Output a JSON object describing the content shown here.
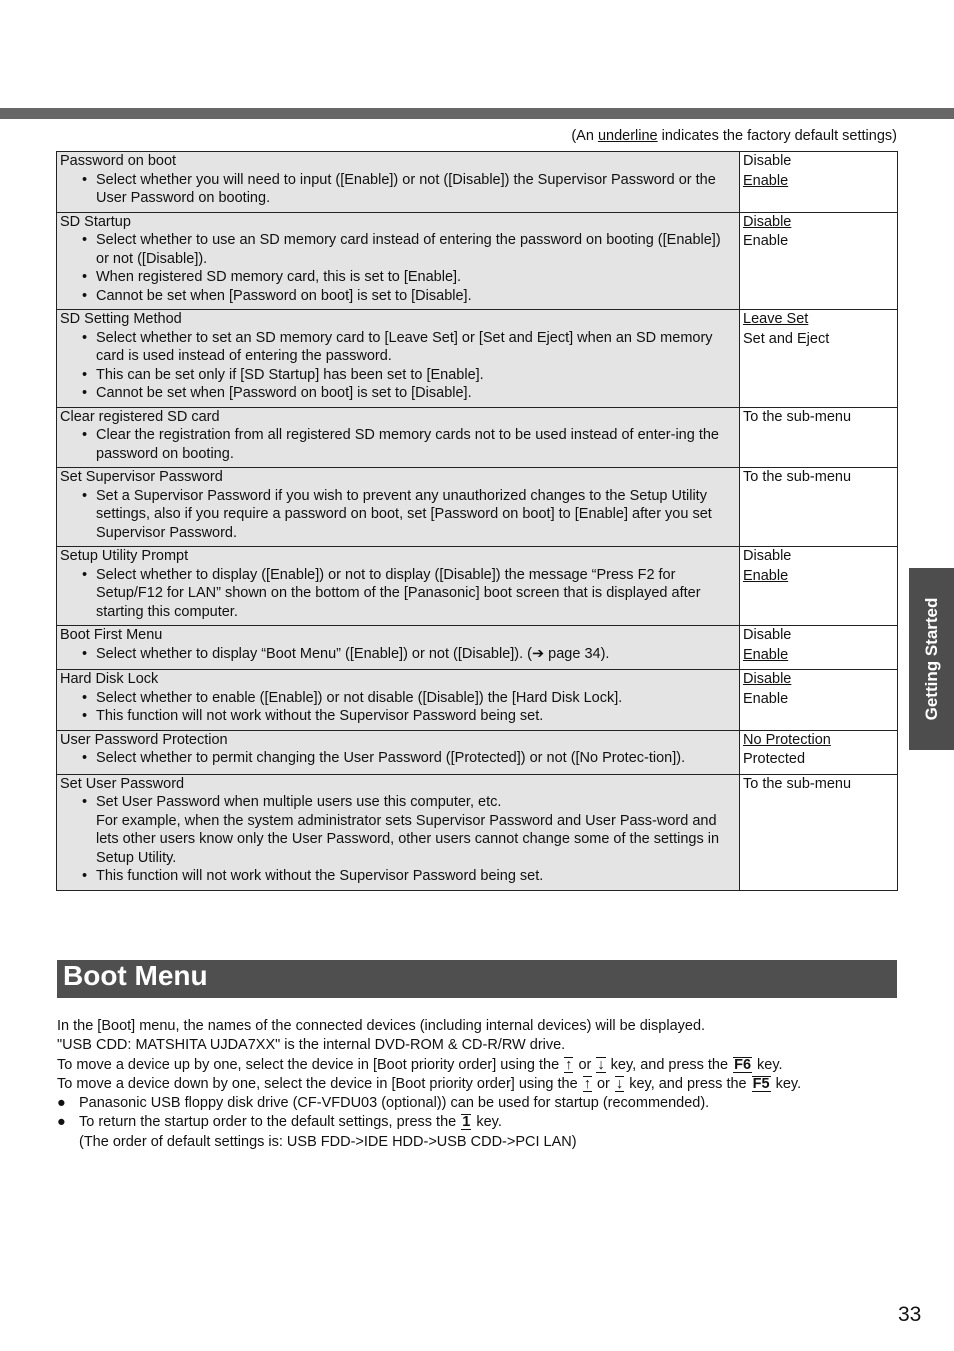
{
  "legend_note": {
    "prefix": "(An ",
    "underlined": "underline",
    "suffix": " indicates the factory default settings)"
  },
  "rows": [
    {
      "title": "Password on boot",
      "bullets": [
        {
          "bullet": true,
          "text": "Select whether you will need to input ([Enable]) or not ([Disable]) the Supervisor Password or the User Password on booting."
        }
      ],
      "options": [
        {
          "label": "Disable",
          "default": false
        },
        {
          "label": "Enable",
          "default": true
        }
      ]
    },
    {
      "title": "SD Startup",
      "bullets": [
        {
          "bullet": true,
          "text": "Select whether to use an SD memory card instead of entering the password on booting ([Enable]) or not ([Disable])."
        },
        {
          "bullet": true,
          "text": "When registered SD memory card, this is set to [Enable]."
        },
        {
          "bullet": true,
          "text": "Cannot be set when [Password on boot] is set to [Disable]."
        }
      ],
      "options": [
        {
          "label": "Disable",
          "default": true
        },
        {
          "label": "Enable",
          "default": false
        }
      ]
    },
    {
      "title": "SD Setting Method",
      "bullets": [
        {
          "bullet": true,
          "text": "Select whether to set an SD memory card to [Leave Set] or [Set and Eject] when an SD memory card is used instead of entering the password."
        },
        {
          "bullet": true,
          "text": "This can be set only if [SD Startup] has been set to [Enable]."
        },
        {
          "bullet": true,
          "text": "Cannot be set when [Password on boot] is set to [Disable]."
        }
      ],
      "options": [
        {
          "label": "Leave Set",
          "default": true
        },
        {
          "label": "Set and Eject",
          "default": false
        }
      ]
    },
    {
      "title": "Clear registered SD card",
      "bullets": [
        {
          "bullet": true,
          "text": "Clear the registration from all registered SD memory cards not to be used instead of enter-ing the password on booting."
        }
      ],
      "options": [
        {
          "label": "To the sub-menu",
          "default": false
        }
      ]
    },
    {
      "title": "Set Supervisor Password",
      "bullets": [
        {
          "bullet": true,
          "text": "Set a Supervisor Password if you wish to prevent any unauthorized changes to the Setup Utility settings, also if you require a password on boot, set [Password on boot] to [Enable] after you set Supervisor Password."
        }
      ],
      "options": [
        {
          "label": "To the sub-menu",
          "default": false
        }
      ]
    },
    {
      "title": "Setup Utility Prompt",
      "bullets": [
        {
          "bullet": true,
          "text": "Select whether to display ([Enable]) or not to display ([Disable]) the message “Press F2 for Setup/F12 for LAN” shown on the bottom of the [Panasonic] boot screen that is displayed after starting this computer."
        }
      ],
      "options": [
        {
          "label": "Disable",
          "default": false
        },
        {
          "label": "Enable",
          "default": true
        }
      ]
    },
    {
      "title": "Boot First Menu",
      "bullets": [
        {
          "bullet": true,
          "text": "Select whether to display “Boot Menu” ([Enable]) or not ([Disable]). (➔ page 34)."
        }
      ],
      "options": [
        {
          "label": "Disable",
          "default": false
        },
        {
          "label": "Enable",
          "default": true
        }
      ]
    },
    {
      "title": "Hard Disk Lock",
      "bullets": [
        {
          "bullet": true,
          "text": "Select whether to enable ([Enable]) or not disable ([Disable]) the [Hard Disk Lock]."
        },
        {
          "bullet": true,
          "text": "This function will not work without the Supervisor Password being set."
        }
      ],
      "options": [
        {
          "label": "Disable",
          "default": true
        },
        {
          "label": "Enable",
          "default": false
        }
      ]
    },
    {
      "title": "User Password Protection",
      "bullets": [
        {
          "bullet": true,
          "text": "Select whether to permit changing the User Password ([Protected]) or not ([No Protec-tion])."
        }
      ],
      "options": [
        {
          "label": "No Protection",
          "default": true
        },
        {
          "label": "Protected",
          "default": false
        }
      ]
    },
    {
      "title": "Set User Password",
      "bullets": [
        {
          "bullet": true,
          "text": "Set User Password when multiple users use this computer, etc."
        },
        {
          "bullet": false,
          "text": "For example, when the system administrator sets Supervisor Password and User Pass-word and lets other users know only the User Password, other users cannot change some of the settings in Setup Utility."
        },
        {
          "bullet": true,
          "text": "This function will not work without the Supervisor Password being set."
        }
      ],
      "options": [
        {
          "label": "To the sub-menu",
          "default": false
        }
      ]
    }
  ],
  "side_tab": "Getting Started",
  "section_title": "Boot Menu",
  "body": {
    "line1": "In the [Boot] menu, the names of the connected devices (including internal devices) will be displayed.",
    "line2": "\"USB CDD: MATSHITA UJDA7XX\" is the internal DVD-ROM & CD-R/RW drive.",
    "line3": {
      "a": "To move a device up by one, select the device in [Boot priority order] using the ",
      "k1": "↑",
      "b": " or ",
      "k2": "↓",
      "c": " key, and press the ",
      "k3": "F6",
      "d": " key."
    },
    "line4": {
      "a": "To move a device down by one, select the device in [Boot priority order] using the ",
      "k1": "↑",
      "b": " or ",
      "k2": "↓",
      "c": " key, and press the ",
      "k3": "F5",
      "d": " key."
    },
    "bullet_char": "●",
    "bullet1": "Panasonic USB floppy disk drive (CF-VFDU03 (optional)) can be used for startup (recommended).",
    "bullet2": {
      "a": "To return the startup order to the default settings, press the ",
      "k": "1",
      "b": " key."
    },
    "bullet2_cont": "(The order of default settings is: USB FDD->IDE HDD->USB CDD->PCI LAN)"
  },
  "page_number": "33"
}
